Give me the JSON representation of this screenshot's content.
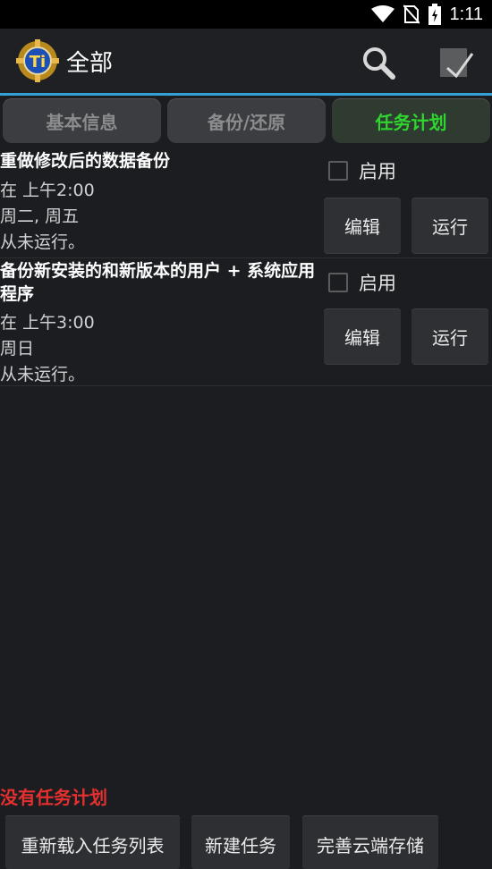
{
  "status_bar": {
    "time": "1:11",
    "icons": [
      "wifi-icon",
      "no-sim-icon",
      "battery-charging-icon"
    ]
  },
  "header": {
    "title": "全部",
    "logo": "titanium-backup-logo",
    "actions": [
      "search-icon",
      "select-all-icon"
    ]
  },
  "tabs": [
    {
      "label": "基本信息",
      "active": false
    },
    {
      "label": "备份/还原",
      "active": false
    },
    {
      "label": "任务计划",
      "active": true
    }
  ],
  "accent": {
    "active_tab_text": "#2ed52e",
    "header_underline": "#33a0d6",
    "warning": "#e53030"
  },
  "tasks": [
    {
      "title": "重做修改后的数据备份",
      "time": "在 上午2:00",
      "days": "周二, 周五",
      "status": "从未运行。",
      "enable_label": "启用",
      "enabled": false,
      "edit_label": "编辑",
      "run_label": "运行"
    },
    {
      "title": "备份新安装的和新版本的用户 + 系统应用程序",
      "time": "在 上午3:00",
      "days": "周日",
      "status": "从未运行。",
      "enable_label": "启用",
      "enabled": false,
      "edit_label": "编辑",
      "run_label": "运行"
    }
  ],
  "footer": {
    "no_tasks_text": "没有任务计划",
    "buttons": [
      "重新载入任务列表",
      "新建任务",
      "完善云端存储"
    ]
  }
}
